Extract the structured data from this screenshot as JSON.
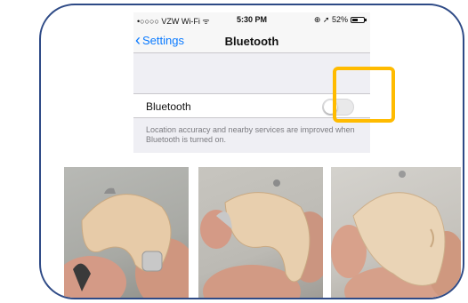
{
  "status_bar": {
    "carrier": "•○○○○ VZW Wi-Fi ᯤ",
    "time": "5:30 PM",
    "battery_text": "⊕ ➚ 52%",
    "battery_level": 0.52
  },
  "nav": {
    "back_label": "Settings",
    "title": "Bluetooth"
  },
  "bluetooth_cell": {
    "label": "Bluetooth",
    "toggle_on": false
  },
  "footer": {
    "text": "Location accuracy and nearby services are improved when Bluetooth is turned on."
  },
  "colors": {
    "frame_border": "#2e4a86",
    "highlight": "#ffbb00",
    "ios_blue": "#0a7aff"
  },
  "icons": {
    "back": "chevron-left-icon",
    "wifi": "wifi-icon",
    "battery": "battery-icon"
  }
}
